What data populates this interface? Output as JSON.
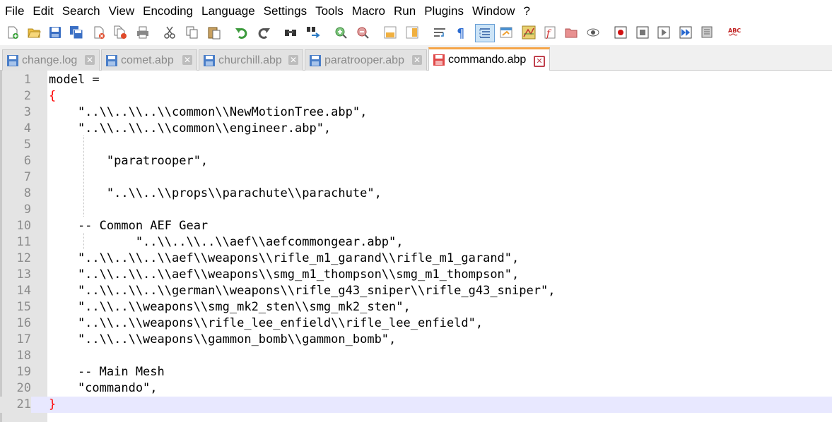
{
  "menu": [
    "File",
    "Edit",
    "Search",
    "View",
    "Encoding",
    "Language",
    "Settings",
    "Tools",
    "Macro",
    "Run",
    "Plugins",
    "Window",
    "?"
  ],
  "toolbar_icons": [
    "new-file-icon",
    "open-file-icon",
    "save-icon",
    "save-all-icon",
    "close-icon",
    "close-all-icon",
    "print-icon",
    "cut-icon",
    "copy-icon",
    "paste-icon",
    "undo-icon",
    "redo-icon",
    "find-icon",
    "replace-icon",
    "zoom-in-icon",
    "zoom-out-icon",
    "sync-vertical-icon",
    "sync-horizontal-icon",
    "word-wrap-icon",
    "show-all-chars-icon",
    "indent-guide-icon",
    "language-icon",
    "document-map-icon",
    "function-list-icon",
    "folder-workspace-icon",
    "monitoring-icon",
    "record-macro-icon",
    "stop-record-icon",
    "play-macro-icon",
    "run-macro-multiple-icon",
    "save-macro-icon",
    "spell-check-icon"
  ],
  "tabs": [
    {
      "label": "change.log",
      "active": false
    },
    {
      "label": "comet.abp",
      "active": false
    },
    {
      "label": "churchill.abp",
      "active": false
    },
    {
      "label": "paratrooper.abp",
      "active": false
    },
    {
      "label": "commando.abp",
      "active": true
    }
  ],
  "colors": {
    "accent_tab": "#f5a447",
    "brace": "#ff0000",
    "current_line": "#e8e8ff",
    "gutter": "#e4e4e4"
  },
  "editor": {
    "lines": [
      {
        "num": "1",
        "text": "model ="
      },
      {
        "num": "2",
        "text": "{"
      },
      {
        "num": "3",
        "text": "    \"..\\\\..\\\\..\\\\common\\\\NewMotionTree.abp\","
      },
      {
        "num": "4",
        "text": "    \"..\\\\..\\\\..\\\\common\\\\engineer.abp\","
      },
      {
        "num": "5",
        "text": ""
      },
      {
        "num": "6",
        "text": "        \"paratrooper\","
      },
      {
        "num": "7",
        "text": ""
      },
      {
        "num": "8",
        "text": "        \"..\\\\..\\\\props\\\\parachute\\\\parachute\","
      },
      {
        "num": "9",
        "text": ""
      },
      {
        "num": "10",
        "text": "    -- Common AEF Gear"
      },
      {
        "num": "11",
        "text": "            \"..\\\\..\\\\..\\\\aef\\\\aefcommongear.abp\","
      },
      {
        "num": "12",
        "text": "    \"..\\\\..\\\\..\\\\aef\\\\weapons\\\\rifle_m1_garand\\\\rifle_m1_garand\","
      },
      {
        "num": "13",
        "text": "    \"..\\\\..\\\\..\\\\aef\\\\weapons\\\\smg_m1_thompson\\\\smg_m1_thompson\","
      },
      {
        "num": "14",
        "text": "    \"..\\\\..\\\\..\\\\german\\\\weapons\\\\rifle_g43_sniper\\\\rifle_g43_sniper\","
      },
      {
        "num": "15",
        "text": "    \"..\\\\..\\\\weapons\\\\smg_mk2_sten\\\\smg_mk2_sten\","
      },
      {
        "num": "16",
        "text": "    \"..\\\\..\\\\weapons\\\\rifle_lee_enfield\\\\rifle_lee_enfield\","
      },
      {
        "num": "17",
        "text": "    \"..\\\\..\\\\weapons\\\\gammon_bomb\\\\gammon_bomb\","
      },
      {
        "num": "18",
        "text": ""
      },
      {
        "num": "19",
        "text": "    -- Main Mesh"
      },
      {
        "num": "20",
        "text": "    \"commando\","
      },
      {
        "num": "21",
        "text": "}"
      }
    ]
  }
}
